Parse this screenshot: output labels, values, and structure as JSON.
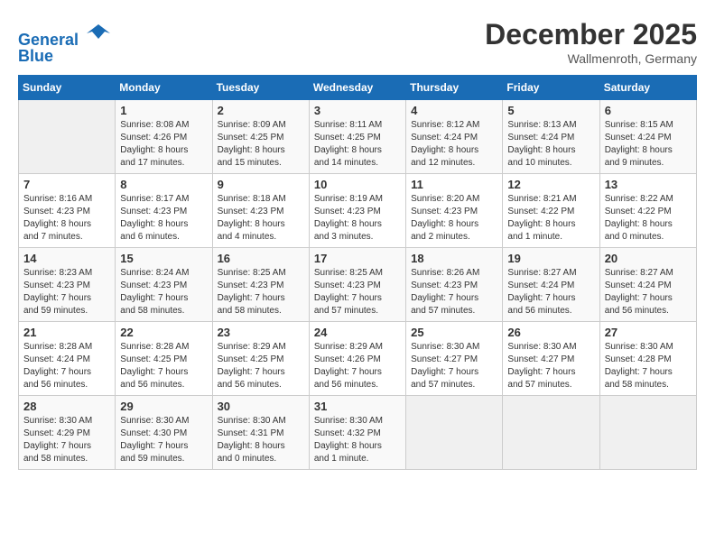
{
  "header": {
    "logo_line1": "General",
    "logo_line2": "Blue",
    "month": "December 2025",
    "location": "Wallmenroth, Germany"
  },
  "days_of_week": [
    "Sunday",
    "Monday",
    "Tuesday",
    "Wednesday",
    "Thursday",
    "Friday",
    "Saturday"
  ],
  "weeks": [
    [
      {
        "num": "",
        "info": ""
      },
      {
        "num": "1",
        "info": "Sunrise: 8:08 AM\nSunset: 4:26 PM\nDaylight: 8 hours\nand 17 minutes."
      },
      {
        "num": "2",
        "info": "Sunrise: 8:09 AM\nSunset: 4:25 PM\nDaylight: 8 hours\nand 15 minutes."
      },
      {
        "num": "3",
        "info": "Sunrise: 8:11 AM\nSunset: 4:25 PM\nDaylight: 8 hours\nand 14 minutes."
      },
      {
        "num": "4",
        "info": "Sunrise: 8:12 AM\nSunset: 4:24 PM\nDaylight: 8 hours\nand 12 minutes."
      },
      {
        "num": "5",
        "info": "Sunrise: 8:13 AM\nSunset: 4:24 PM\nDaylight: 8 hours\nand 10 minutes."
      },
      {
        "num": "6",
        "info": "Sunrise: 8:15 AM\nSunset: 4:24 PM\nDaylight: 8 hours\nand 9 minutes."
      }
    ],
    [
      {
        "num": "7",
        "info": "Sunrise: 8:16 AM\nSunset: 4:23 PM\nDaylight: 8 hours\nand 7 minutes."
      },
      {
        "num": "8",
        "info": "Sunrise: 8:17 AM\nSunset: 4:23 PM\nDaylight: 8 hours\nand 6 minutes."
      },
      {
        "num": "9",
        "info": "Sunrise: 8:18 AM\nSunset: 4:23 PM\nDaylight: 8 hours\nand 4 minutes."
      },
      {
        "num": "10",
        "info": "Sunrise: 8:19 AM\nSunset: 4:23 PM\nDaylight: 8 hours\nand 3 minutes."
      },
      {
        "num": "11",
        "info": "Sunrise: 8:20 AM\nSunset: 4:23 PM\nDaylight: 8 hours\nand 2 minutes."
      },
      {
        "num": "12",
        "info": "Sunrise: 8:21 AM\nSunset: 4:22 PM\nDaylight: 8 hours\nand 1 minute."
      },
      {
        "num": "13",
        "info": "Sunrise: 8:22 AM\nSunset: 4:22 PM\nDaylight: 8 hours\nand 0 minutes."
      }
    ],
    [
      {
        "num": "14",
        "info": "Sunrise: 8:23 AM\nSunset: 4:23 PM\nDaylight: 7 hours\nand 59 minutes."
      },
      {
        "num": "15",
        "info": "Sunrise: 8:24 AM\nSunset: 4:23 PM\nDaylight: 7 hours\nand 58 minutes."
      },
      {
        "num": "16",
        "info": "Sunrise: 8:25 AM\nSunset: 4:23 PM\nDaylight: 7 hours\nand 58 minutes."
      },
      {
        "num": "17",
        "info": "Sunrise: 8:25 AM\nSunset: 4:23 PM\nDaylight: 7 hours\nand 57 minutes."
      },
      {
        "num": "18",
        "info": "Sunrise: 8:26 AM\nSunset: 4:23 PM\nDaylight: 7 hours\nand 57 minutes."
      },
      {
        "num": "19",
        "info": "Sunrise: 8:27 AM\nSunset: 4:24 PM\nDaylight: 7 hours\nand 56 minutes."
      },
      {
        "num": "20",
        "info": "Sunrise: 8:27 AM\nSunset: 4:24 PM\nDaylight: 7 hours\nand 56 minutes."
      }
    ],
    [
      {
        "num": "21",
        "info": "Sunrise: 8:28 AM\nSunset: 4:24 PM\nDaylight: 7 hours\nand 56 minutes."
      },
      {
        "num": "22",
        "info": "Sunrise: 8:28 AM\nSunset: 4:25 PM\nDaylight: 7 hours\nand 56 minutes."
      },
      {
        "num": "23",
        "info": "Sunrise: 8:29 AM\nSunset: 4:25 PM\nDaylight: 7 hours\nand 56 minutes."
      },
      {
        "num": "24",
        "info": "Sunrise: 8:29 AM\nSunset: 4:26 PM\nDaylight: 7 hours\nand 56 minutes."
      },
      {
        "num": "25",
        "info": "Sunrise: 8:30 AM\nSunset: 4:27 PM\nDaylight: 7 hours\nand 57 minutes."
      },
      {
        "num": "26",
        "info": "Sunrise: 8:30 AM\nSunset: 4:27 PM\nDaylight: 7 hours\nand 57 minutes."
      },
      {
        "num": "27",
        "info": "Sunrise: 8:30 AM\nSunset: 4:28 PM\nDaylight: 7 hours\nand 58 minutes."
      }
    ],
    [
      {
        "num": "28",
        "info": "Sunrise: 8:30 AM\nSunset: 4:29 PM\nDaylight: 7 hours\nand 58 minutes."
      },
      {
        "num": "29",
        "info": "Sunrise: 8:30 AM\nSunset: 4:30 PM\nDaylight: 7 hours\nand 59 minutes."
      },
      {
        "num": "30",
        "info": "Sunrise: 8:30 AM\nSunset: 4:31 PM\nDaylight: 8 hours\nand 0 minutes."
      },
      {
        "num": "31",
        "info": "Sunrise: 8:30 AM\nSunset: 4:32 PM\nDaylight: 8 hours\nand 1 minute."
      },
      {
        "num": "",
        "info": ""
      },
      {
        "num": "",
        "info": ""
      },
      {
        "num": "",
        "info": ""
      }
    ]
  ]
}
